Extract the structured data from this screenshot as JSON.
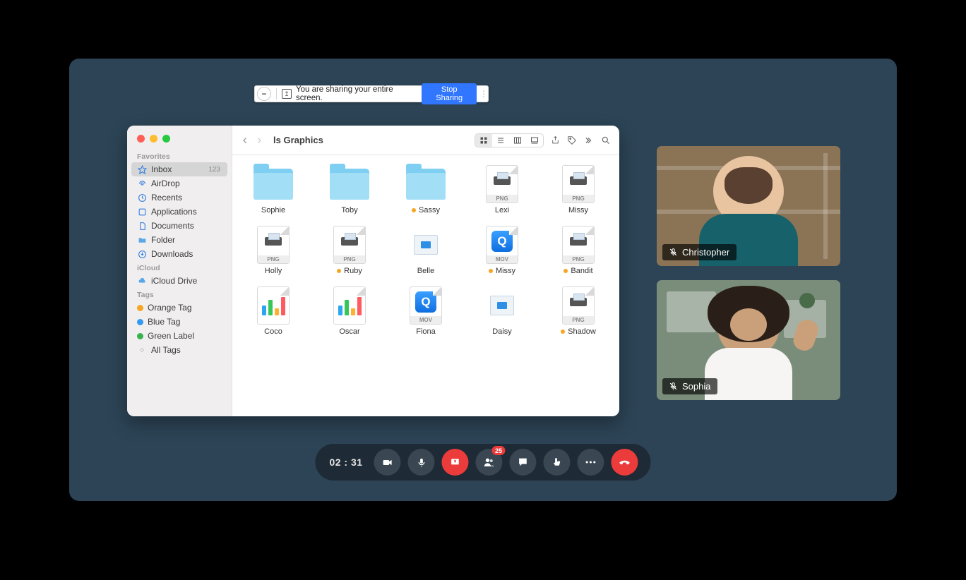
{
  "share_banner": {
    "text": "You are sharing your entire screen.",
    "stop": "Stop Sharing"
  },
  "finder": {
    "title": "ls Graphics",
    "favorites_header": "Favorites",
    "icloud_header": "iCloud",
    "tags_header": "Tags",
    "sidebar": {
      "inbox": {
        "label": "Inbox",
        "count": "123"
      },
      "airdrop": "AirDrop",
      "recents": "Recents",
      "applications": "Applications",
      "documents": "Documents",
      "folder": "Folder",
      "downloads": "Downloads",
      "icloud": "iCloud Drive",
      "orange": "Orange Tag",
      "blue": "Blue Tag",
      "green": "Green Label",
      "all": "All Tags"
    },
    "items": {
      "r1": [
        {
          "name": "Sophie",
          "type": "folder",
          "tag": false
        },
        {
          "name": "Toby",
          "type": "folder",
          "tag": false
        },
        {
          "name": "Sassy",
          "type": "folder",
          "tag": true
        },
        {
          "name": "Lexi",
          "type": "png",
          "tag": false
        },
        {
          "name": "Missy",
          "type": "png",
          "tag": false
        }
      ],
      "r2": [
        {
          "name": "Holly",
          "type": "png",
          "tag": false
        },
        {
          "name": "Ruby",
          "type": "png",
          "tag": true
        },
        {
          "name": "Belle",
          "type": "keynote",
          "tag": false
        },
        {
          "name": "Missy",
          "type": "mov",
          "tag": true
        },
        {
          "name": "Bandit",
          "type": "png",
          "tag": true
        }
      ],
      "r3": [
        {
          "name": "Coco",
          "type": "chart",
          "tag": false
        },
        {
          "name": "Oscar",
          "type": "chart",
          "tag": false
        },
        {
          "name": "Fiona",
          "type": "mov",
          "tag": false
        },
        {
          "name": "Daisy",
          "type": "keynote",
          "tag": false
        },
        {
          "name": "Shadow",
          "type": "png",
          "tag": true
        }
      ]
    }
  },
  "participants": {
    "p1": "Christopher",
    "p2": "Sophia"
  },
  "dock": {
    "timer": "02 : 31",
    "notifications": "25"
  }
}
